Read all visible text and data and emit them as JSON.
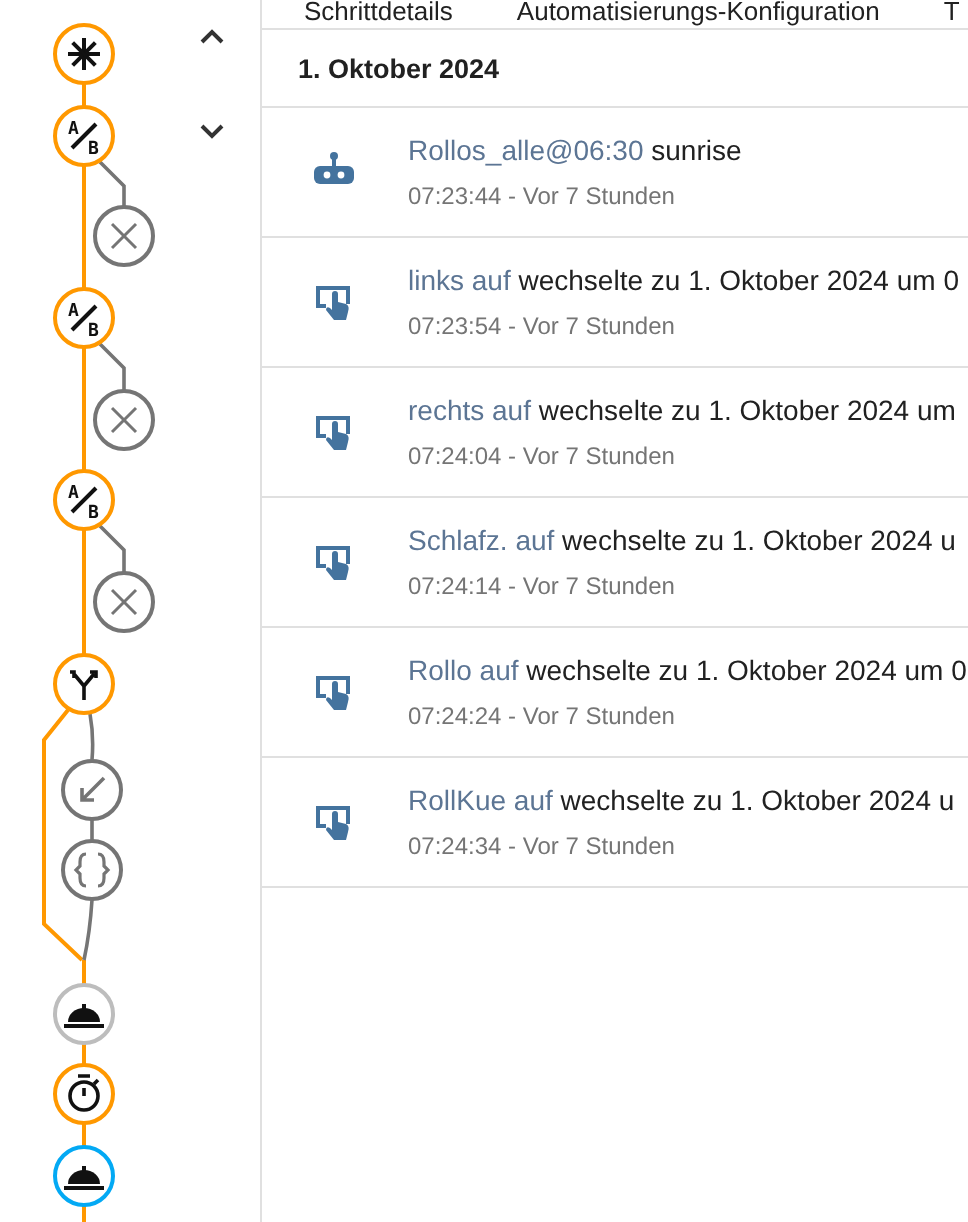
{
  "nav": {
    "buttons": [
      {
        "kind": "up"
      },
      {
        "kind": "down"
      }
    ]
  },
  "graph": {
    "nodes": [
      {
        "kind": "trigger",
        "color": "#ff9800"
      },
      {
        "kind": "choose",
        "color": "#ff9800",
        "letters": [
          "A",
          "B"
        ]
      },
      {
        "kind": "stop",
        "color": "#757575"
      },
      {
        "kind": "choose",
        "color": "#ff9800",
        "letters": [
          "A",
          "B"
        ]
      },
      {
        "kind": "stop",
        "color": "#757575"
      },
      {
        "kind": "choose",
        "color": "#ff9800",
        "letters": [
          "A",
          "B"
        ]
      },
      {
        "kind": "stop",
        "color": "#757575"
      },
      {
        "kind": "parallel",
        "color": "#ff9800"
      },
      {
        "kind": "call",
        "color": "#757575"
      },
      {
        "kind": "variables",
        "color": "#757575"
      },
      {
        "kind": "service",
        "color": "#bdbdbd"
      },
      {
        "kind": "delay",
        "color": "#ff9800"
      },
      {
        "kind": "service",
        "color": "#03a9f4"
      }
    ]
  },
  "tabs": [
    {
      "label": "Schrittdetails"
    },
    {
      "label": "Automatisierungs-Konfiguration"
    },
    {
      "label": "T"
    }
  ],
  "date_header": "1. Oktober 2024",
  "entries": [
    {
      "kind": "automation",
      "link": "Rollos_alle@06:30",
      "text": "sunrise",
      "time": "07:23:44 - Vor 7 Stunden"
    },
    {
      "kind": "state",
      "link": "links auf",
      "text": "wechselte zu 1. Oktober 2024 um 0",
      "time": "07:23:54 - Vor 7 Stunden"
    },
    {
      "kind": "state",
      "link": "rechts auf",
      "text": "wechselte zu 1. Oktober 2024 um",
      "time": "07:24:04 - Vor 7 Stunden"
    },
    {
      "kind": "state",
      "link": "Schlafz. auf",
      "text": "wechselte zu 1. Oktober 2024 u",
      "time": "07:24:14 - Vor 7 Stunden"
    },
    {
      "kind": "state",
      "link": "Rollo auf",
      "text": "wechselte zu 1. Oktober 2024 um 0",
      "time": "07:24:24 - Vor 7 Stunden"
    },
    {
      "kind": "state",
      "link": "RollKue auf",
      "text": "wechselte zu 1. Oktober 2024 u",
      "time": "07:24:34 - Vor 7 Stunden"
    }
  ]
}
